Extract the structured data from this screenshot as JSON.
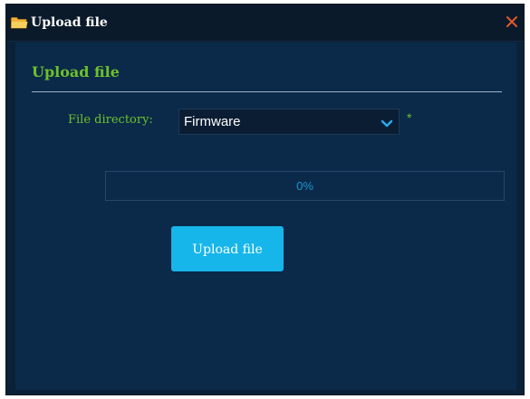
{
  "window": {
    "title": "Upload file",
    "title_icon": "folder-icon",
    "close_icon": "close-icon"
  },
  "form": {
    "section_title": "Upload file",
    "directory_label": "File directory:",
    "directory_value": "Firmware",
    "directory_chevron_icon": "chevron-down-icon",
    "required_mark": "*",
    "progress_percent": 0,
    "progress_text": "0%",
    "upload_button_label": "Upload file"
  },
  "colors": {
    "accent_green": "#6ec02a",
    "button_blue": "#16b6ea",
    "progress_text_blue": "#1b96cf",
    "close_orange": "#e2592a",
    "content_bg": "#0b2a4a"
  }
}
